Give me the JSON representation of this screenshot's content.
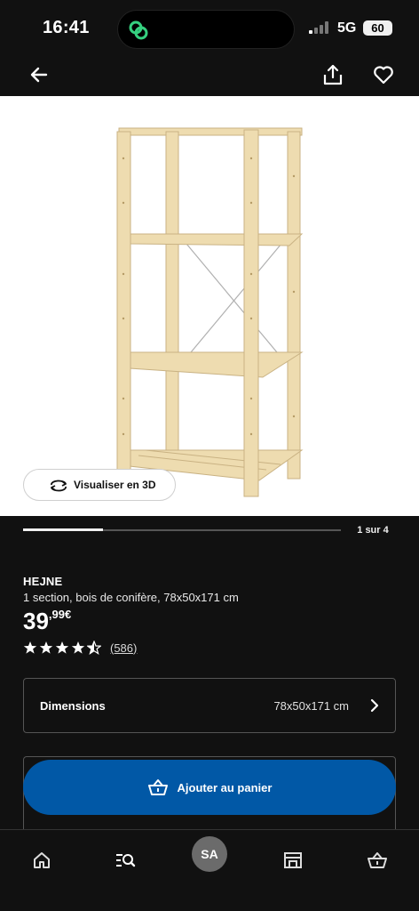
{
  "status_bar": {
    "time": "16:41",
    "network": "5G",
    "battery": "60",
    "icons": [
      "link-icon",
      "signal-icon"
    ]
  },
  "nav": {
    "icons": [
      "back-arrow-icon",
      "share-icon",
      "heart-icon"
    ]
  },
  "image": {
    "view_3d_label": "Visualiser en 3D",
    "view_3d_icon": "rotate-3d-icon",
    "carousel_counter": "1 sur 4",
    "carousel_progress": 0.25
  },
  "product": {
    "name": "HEJNE",
    "description": "1 section, bois de conifère, 78x50x171 cm",
    "price_int": "39",
    "price_dec": ",99€",
    "rating": 4.5,
    "review_count": "(586)"
  },
  "dimensions": {
    "label": "Dimensions",
    "value": "78x50x171 cm"
  },
  "cart": {
    "add_label": "Ajouter au panier",
    "icon": "basket-icon"
  },
  "tabbar": {
    "avatar_initials": "SA",
    "icons": [
      "home-icon",
      "search-list-icon",
      "avatar",
      "store-icon",
      "basket-icon"
    ]
  },
  "colors": {
    "background": "#111111",
    "accent_blue": "#0158a6",
    "wood": "#eedcb0"
  }
}
